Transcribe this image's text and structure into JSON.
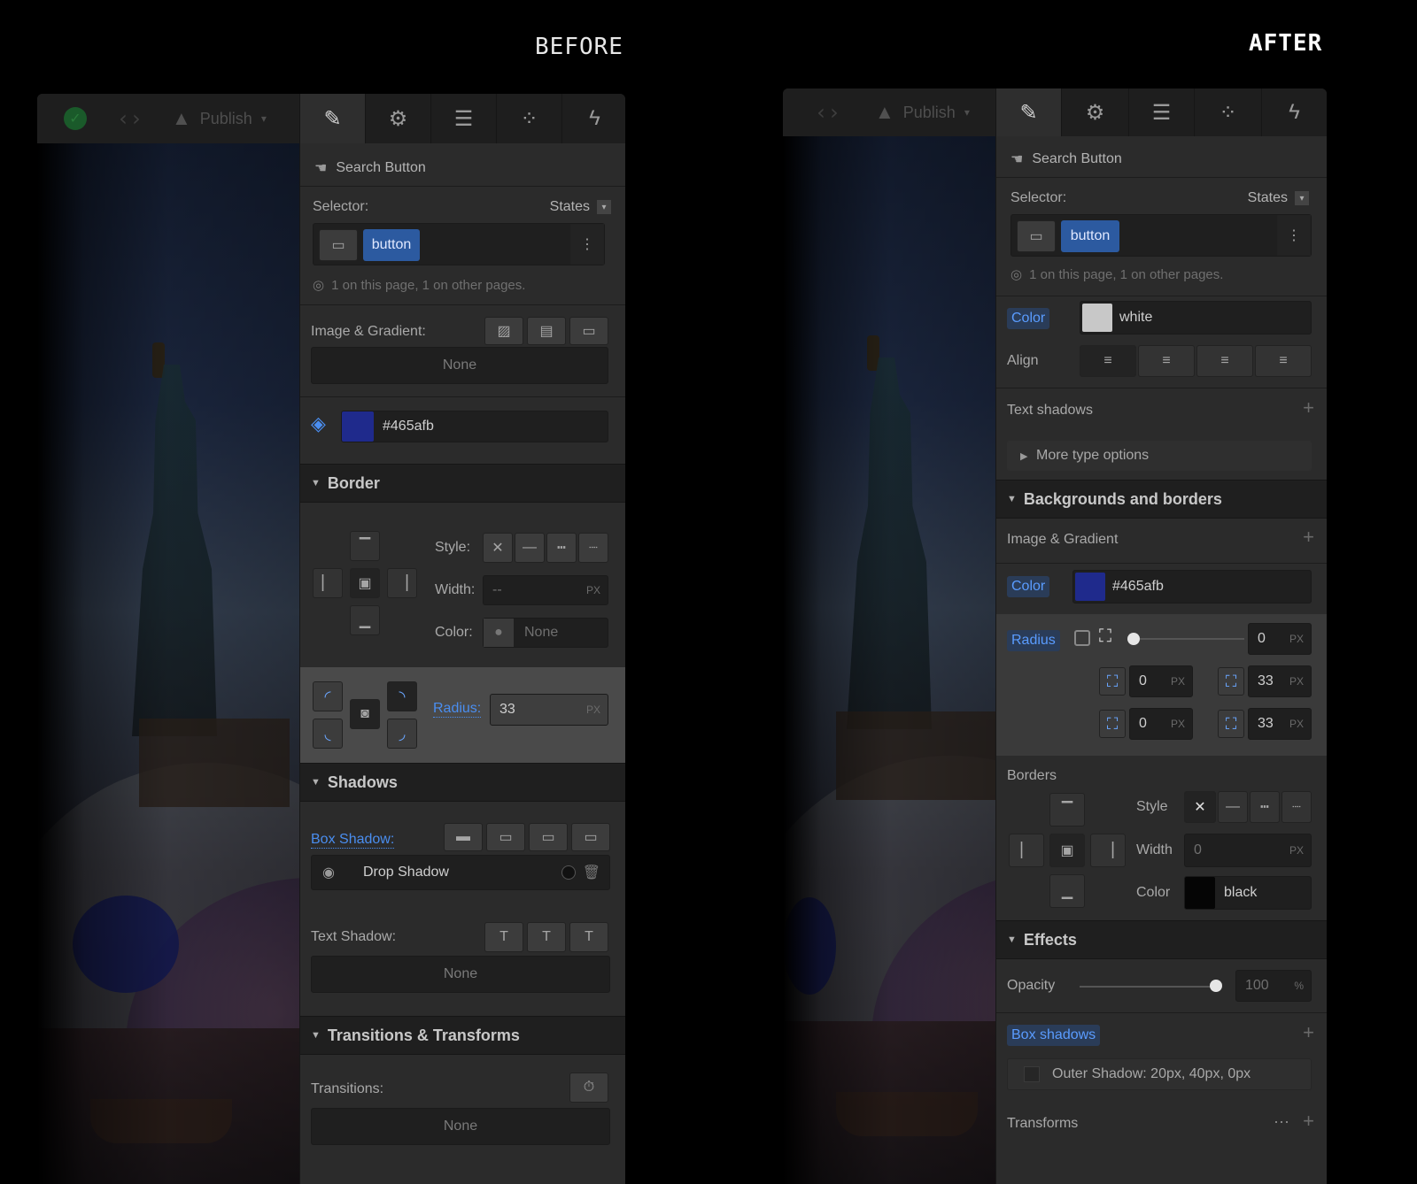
{
  "headings": {
    "before": "BEFORE",
    "after": "AFTER"
  },
  "topbar": {
    "code_icon": "‹›",
    "publish_label": "Publish",
    "tabs": [
      "brush-icon",
      "gear-icon",
      "list-icon",
      "drops-icon",
      "bolt-icon"
    ]
  },
  "before": {
    "element_name": "Search Button",
    "selector_label": "Selector:",
    "states_label": "States",
    "selector_chip": "button",
    "usage": "1 on this page, 1 on other pages.",
    "image_gradient_label": "Image & Gradient:",
    "image_gradient_value": "None",
    "bg_color": "#465afb",
    "bg_swatch": "#1f2a8c",
    "border_header": "Border",
    "style_label": "Style:",
    "width_label": "Width:",
    "width_value": "--",
    "width_unit": "PX",
    "color_label": "Color:",
    "color_value": "None",
    "radius_label": "Radius:",
    "radius_value": "33",
    "radius_unit": "PX",
    "shadows_header": "Shadows",
    "box_shadow_label": "Box Shadow:",
    "drop_shadow": "Drop Shadow",
    "text_shadow_label": "Text Shadow:",
    "text_shadow_value": "None",
    "transitions_header": "Transitions & Transforms",
    "transitions_label": "Transitions:",
    "transitions_value": "None"
  },
  "after": {
    "element_name": "Search Button",
    "selector_label": "Selector:",
    "states_label": "States",
    "selector_chip": "button",
    "usage": "1 on this page, 1 on other pages.",
    "color_label": "Color",
    "color_value": "white",
    "align_label": "Align",
    "text_shadows_label": "Text shadows",
    "more_type": "More type options",
    "bg_borders_header": "Backgrounds and borders",
    "image_gradient_label": "Image & Gradient",
    "bg_color_label": "Color",
    "bg_color": "#465afb",
    "bg_swatch": "#1f2a8c",
    "radius_label": "Radius",
    "radius_all": "0",
    "radius_tl": "0",
    "radius_tr": "33",
    "radius_bl": "0",
    "radius_br": "33",
    "px": "PX",
    "borders_label": "Borders",
    "style_label": "Style",
    "width_label": "Width",
    "width_value": "0",
    "border_color_label": "Color",
    "border_color_value": "black",
    "effects_header": "Effects",
    "opacity_label": "Opacity",
    "opacity_value": "100",
    "opacity_unit": "%",
    "opacity_level": 1.0,
    "box_shadows_label": "Box shadows",
    "outer_shadow": "Outer Shadow: 20px, 40px, 0px",
    "transforms_label": "Transforms"
  }
}
